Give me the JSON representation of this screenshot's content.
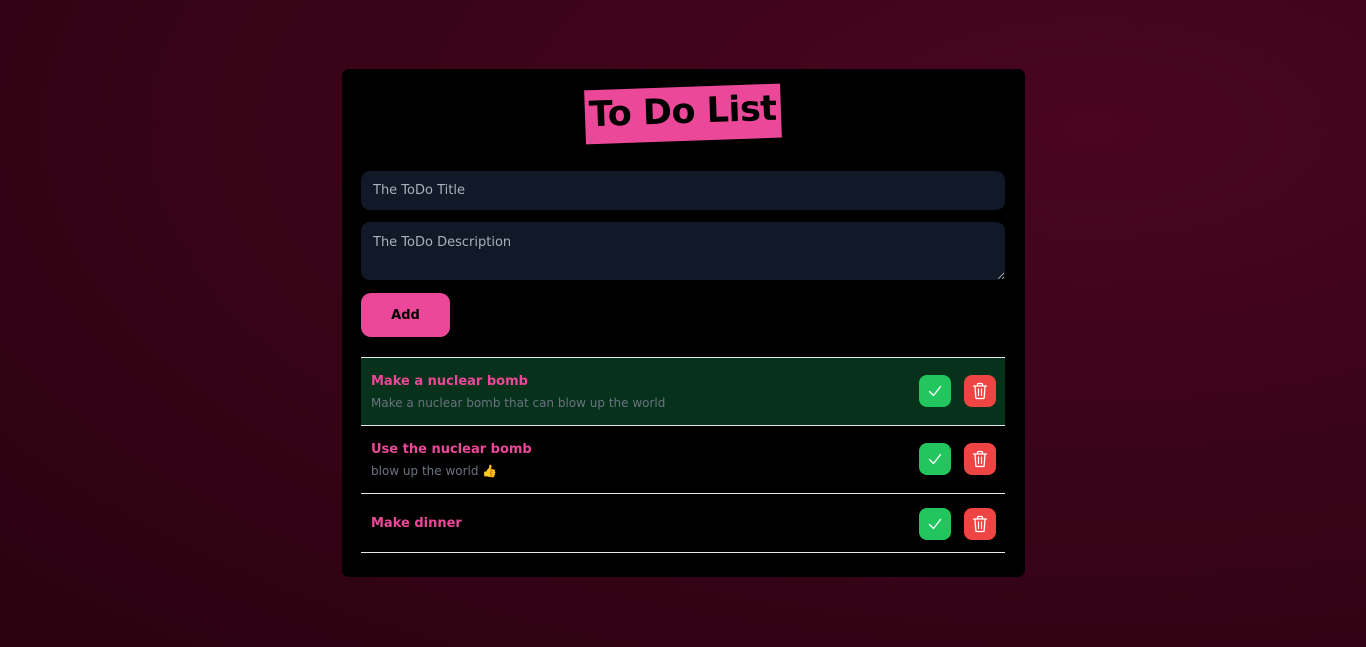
{
  "app": {
    "title": "To Do List"
  },
  "form": {
    "title_placeholder": "The ToDo Title",
    "title_value": "",
    "description_placeholder": "The ToDo Description",
    "description_value": "",
    "add_label": "Add"
  },
  "todos": [
    {
      "title": "Make a nuclear bomb",
      "description": "Make a nuclear bomb that can blow up the world",
      "completed": true
    },
    {
      "title": "Use the nuclear bomb",
      "description": "blow up the world 👍",
      "completed": false
    },
    {
      "title": "Make dinner",
      "description": "",
      "completed": false
    }
  ],
  "icons": {
    "complete": "check-icon",
    "delete": "trash-icon"
  },
  "colors": {
    "accent": "#ec4899",
    "complete_button": "#22c55e",
    "delete_button": "#ef4444",
    "completed_row": "#06311a",
    "input_bg": "#111827"
  }
}
